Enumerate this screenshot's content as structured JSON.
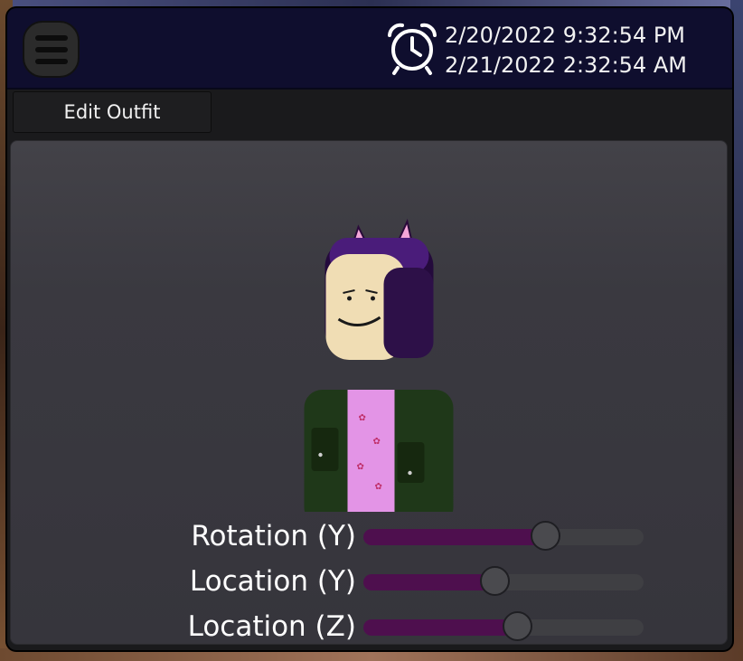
{
  "header": {
    "menu_icon": "hamburger-menu-icon",
    "clock_icon": "alarm-clock-icon",
    "time_primary": "2/20/2022 9:32:54 PM",
    "time_secondary": "2/21/2022 2:32:54 AM"
  },
  "toolbar": {
    "edit_outfit_label": "Edit Outfit"
  },
  "sliders": [
    {
      "label": "Rotation (Y)",
      "value": 0.65
    },
    {
      "label": "Location (Y)",
      "value": 0.47
    },
    {
      "label": "Location (Z)",
      "value": 0.55
    }
  ],
  "colors": {
    "topbar": "#0f0e2e",
    "slider_fill": "#4e0f4e",
    "panel": "#3a3940"
  }
}
